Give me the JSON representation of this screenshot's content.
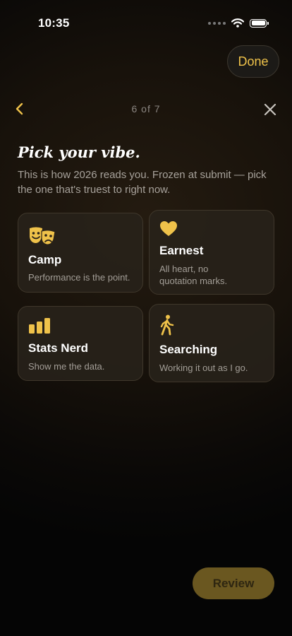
{
  "status_bar": {
    "time": "10:35"
  },
  "header": {
    "done_label": "Done",
    "step_counter": "6 of 7"
  },
  "main": {
    "title": "Pick your vibe.",
    "subtitle": "This is how 2026 reads you. Frozen at submit — pick the one that's truest to right now."
  },
  "options": [
    {
      "name": "Camp",
      "description": "Performance is the point.",
      "icon": "theater-masks-icon",
      "selected": false
    },
    {
      "name": "Earnest",
      "description": "All heart, no quotation marks.",
      "icon": "heart-icon",
      "selected": false
    },
    {
      "name": "Stats Nerd",
      "description": "Show me the data.",
      "icon": "bar-chart-icon",
      "selected": false
    },
    {
      "name": "Searching",
      "description": "Working it out as I go.",
      "icon": "walking-person-icon",
      "selected": false
    }
  ],
  "footer": {
    "review_label": "Review"
  },
  "colors": {
    "accent": "#EFC24A",
    "review_disabled": "#6A5720",
    "card_background": "#28221A"
  }
}
